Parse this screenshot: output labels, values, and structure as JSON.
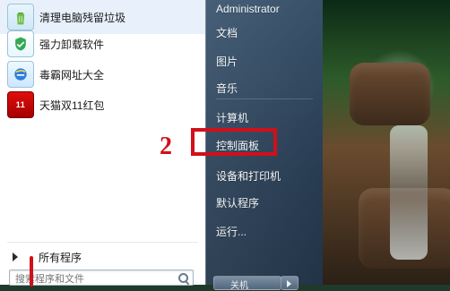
{
  "window": {
    "bg_scene": "waterfall",
    "accent_red": "#d0101a"
  },
  "left_programs": [
    {
      "label": "清理电脑残留垃圾",
      "icon": "recycle-bin-icon"
    },
    {
      "label": "强力卸载软件",
      "icon": "uninstall-shield-icon"
    },
    {
      "label": "毒霸网址大全",
      "icon": "internet-explorer-icon"
    },
    {
      "label": "天猫双11红包",
      "icon": "tmall-red-packet-icon"
    }
  ],
  "all_programs": {
    "label": "所有程序"
  },
  "search": {
    "placeholder": "搜索程序和文件"
  },
  "right_pane": {
    "user": "Administrator",
    "items": [
      "文档",
      "图片",
      "音乐",
      "计算机",
      "控制面板",
      "设备和打印机",
      "默认程序",
      "运行..."
    ]
  },
  "shutdown": {
    "label": "关机"
  },
  "annotations": {
    "step_number": "2"
  }
}
